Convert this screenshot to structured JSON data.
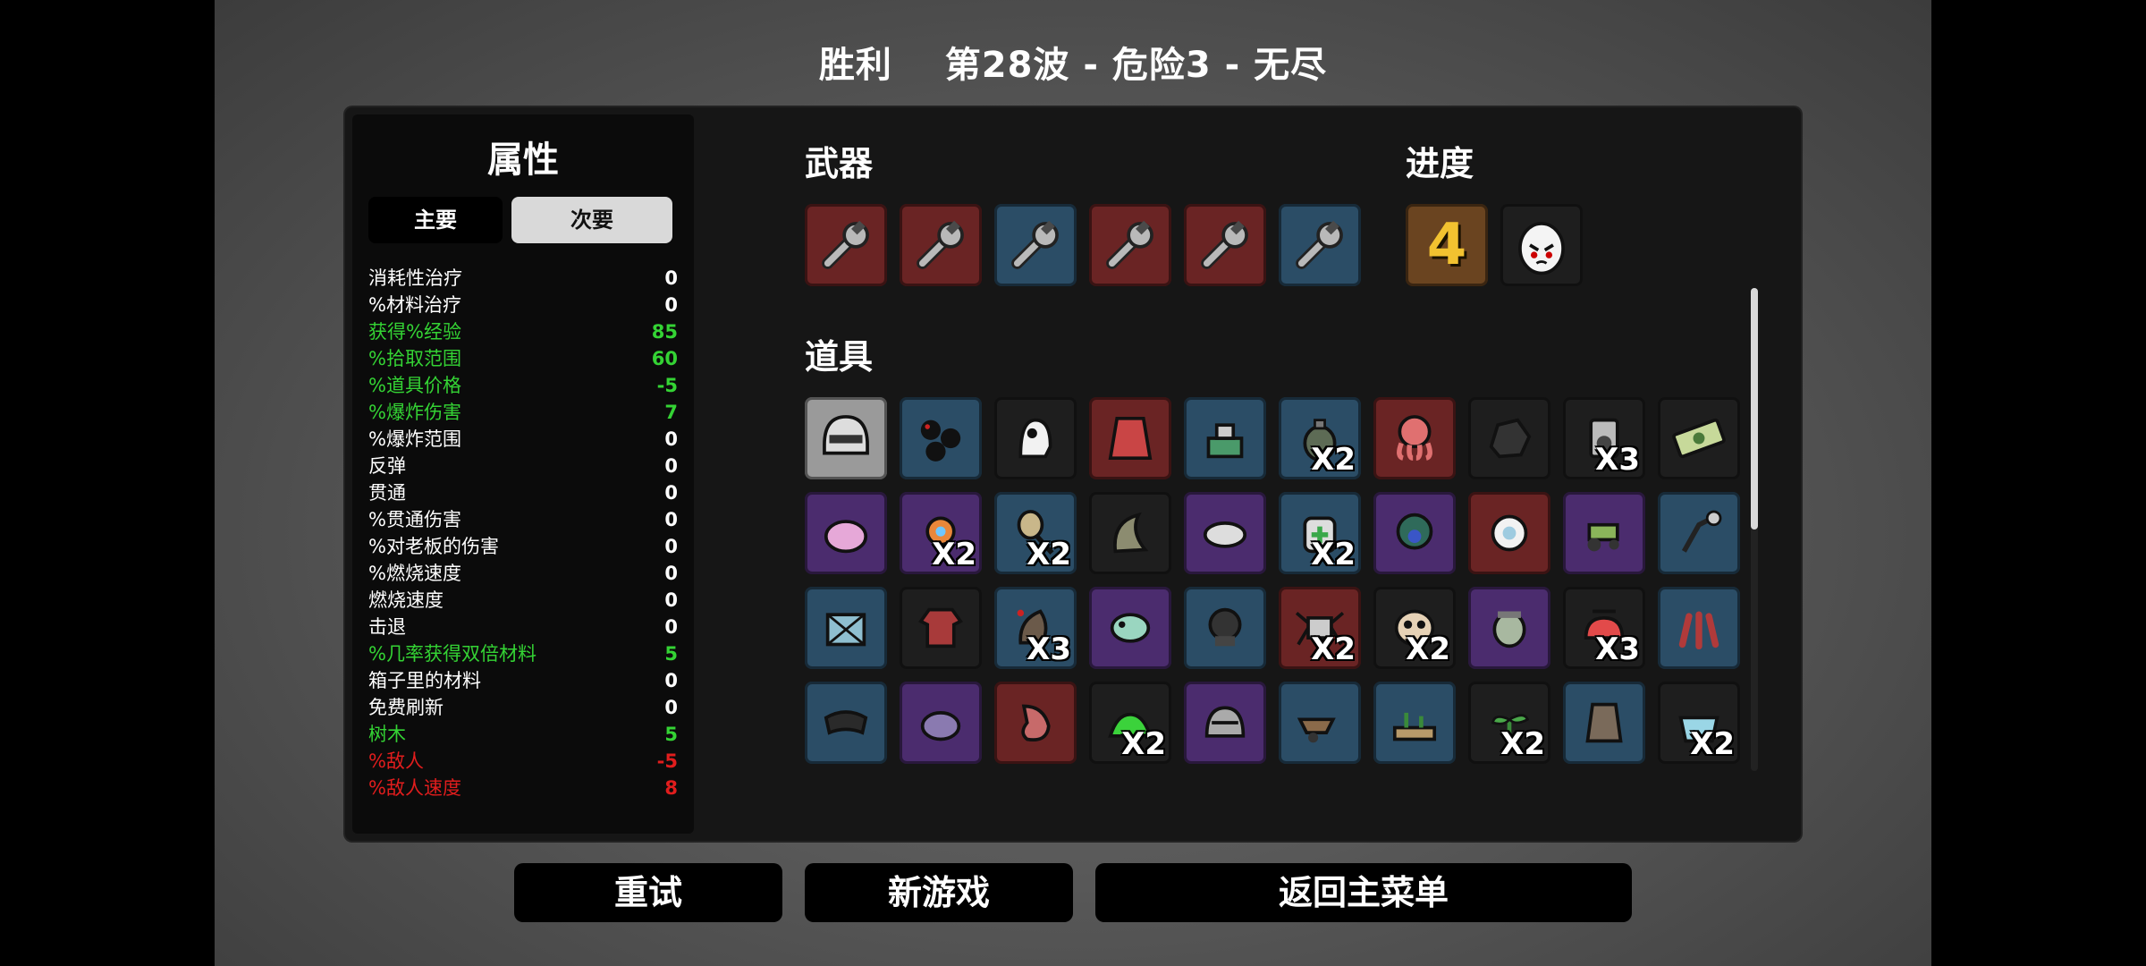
{
  "header": {
    "result": "胜利",
    "wave_info": "第28波 - 危险3 - 无尽"
  },
  "stats": {
    "title": "属性",
    "tabs": {
      "primary": "主要",
      "secondary": "次要"
    },
    "rows": [
      {
        "label": "消耗性治疗",
        "value": "0",
        "tone": "neutral"
      },
      {
        "label": "%材料治疗",
        "value": "0",
        "tone": "neutral"
      },
      {
        "label": "获得%经验",
        "value": "85",
        "tone": "pos"
      },
      {
        "label": "%拾取范围",
        "value": "60",
        "tone": "pos"
      },
      {
        "label": "%道具价格",
        "value": "-5",
        "tone": "pos"
      },
      {
        "label": "%爆炸伤害",
        "value": "7",
        "tone": "pos"
      },
      {
        "label": "%爆炸范围",
        "value": "0",
        "tone": "neutral"
      },
      {
        "label": "反弹",
        "value": "0",
        "tone": "neutral"
      },
      {
        "label": "贯通",
        "value": "0",
        "tone": "neutral"
      },
      {
        "label": "%贯通伤害",
        "value": "0",
        "tone": "neutral"
      },
      {
        "label": "%对老板的伤害",
        "value": "0",
        "tone": "neutral"
      },
      {
        "label": "%燃烧速度",
        "value": "0",
        "tone": "neutral"
      },
      {
        "label": "燃烧速度",
        "value": "0",
        "tone": "neutral"
      },
      {
        "label": "击退",
        "value": "0",
        "tone": "neutral"
      },
      {
        "label": "%几率获得双倍材料",
        "value": "5",
        "tone": "pos"
      },
      {
        "label": "箱子里的材料",
        "value": "0",
        "tone": "neutral"
      },
      {
        "label": "免费刷新",
        "value": "0",
        "tone": "neutral"
      },
      {
        "label": "树木",
        "value": "5",
        "tone": "pos"
      },
      {
        "label": "%敌人",
        "value": "-5",
        "tone": "neg"
      },
      {
        "label": "%敌人速度",
        "value": "8",
        "tone": "neg"
      }
    ]
  },
  "weapons": {
    "label": "武器",
    "items": [
      {
        "icon": "wrench-icon",
        "tier": "tier-4"
      },
      {
        "icon": "wrench-icon",
        "tier": "tier-4"
      },
      {
        "icon": "wrench-icon",
        "tier": "tier-2"
      },
      {
        "icon": "wrench-icon",
        "tier": "tier-4"
      },
      {
        "icon": "wrench-icon",
        "tier": "tier-4"
      },
      {
        "icon": "wrench-icon",
        "tier": "tier-2"
      }
    ]
  },
  "progress": {
    "label": "进度",
    "danger_level": "4",
    "character_icon": "egg-face-icon"
  },
  "items": {
    "label": "道具",
    "list": [
      {
        "icon": "helmet-icon",
        "tier": "tier-white",
        "qty": ""
      },
      {
        "icon": "bombs-icon",
        "tier": "tier-2",
        "qty": ""
      },
      {
        "icon": "ghost-icon",
        "tier": "tier-1",
        "qty": ""
      },
      {
        "icon": "cape-icon",
        "tier": "tier-4",
        "qty": ""
      },
      {
        "icon": "turret-icon",
        "tier": "tier-2",
        "qty": ""
      },
      {
        "icon": "grenade-icon",
        "tier": "tier-2",
        "qty": "X2"
      },
      {
        "icon": "octopus-icon",
        "tier": "tier-4",
        "qty": ""
      },
      {
        "icon": "rock-icon",
        "tier": "tier-1",
        "qty": ""
      },
      {
        "icon": "speaker-icon",
        "tier": "tier-1",
        "qty": "X3"
      },
      {
        "icon": "cash-icon",
        "tier": "tier-1",
        "qty": ""
      },
      {
        "icon": "brain-icon",
        "tier": "tier-3",
        "qty": ""
      },
      {
        "icon": "robot-icon",
        "tier": "tier-3",
        "qty": "X2"
      },
      {
        "icon": "mirror-icon",
        "tier": "tier-2",
        "qty": "X2"
      },
      {
        "icon": "horn-icon",
        "tier": "tier-1",
        "qty": ""
      },
      {
        "icon": "tardigrade-icon",
        "tier": "tier-3",
        "qty": ""
      },
      {
        "icon": "medkit-icon",
        "tier": "tier-2",
        "qty": "X2"
      },
      {
        "icon": "peacock-icon",
        "tier": "tier-3",
        "qty": ""
      },
      {
        "icon": "burst-icon",
        "tier": "tier-4",
        "qty": ""
      },
      {
        "icon": "tractor-icon",
        "tier": "tier-3",
        "qty": ""
      },
      {
        "icon": "lamp-icon",
        "tier": "tier-2",
        "qty": ""
      },
      {
        "icon": "crate-icon",
        "tier": "tier-2",
        "qty": ""
      },
      {
        "icon": "shirt-icon",
        "tier": "tier-1",
        "qty": ""
      },
      {
        "icon": "larva-icon",
        "tier": "tier-2",
        "qty": "X3"
      },
      {
        "icon": "chameleon-icon",
        "tier": "tier-3",
        "qty": ""
      },
      {
        "icon": "diving-helmet-icon",
        "tier": "tier-2",
        "qty": ""
      },
      {
        "icon": "spider-bot-icon",
        "tier": "tier-4",
        "qty": "X2"
      },
      {
        "icon": "mask-icon",
        "tier": "tier-1",
        "qty": "X2"
      },
      {
        "icon": "zombie-icon",
        "tier": "tier-3",
        "qty": ""
      },
      {
        "icon": "propeller-hat-icon",
        "tier": "tier-1",
        "qty": "X3"
      },
      {
        "icon": "claws-icon",
        "tier": "tier-2",
        "qty": ""
      },
      {
        "icon": "scarf-icon",
        "tier": "tier-2",
        "qty": ""
      },
      {
        "icon": "blob-icon",
        "tier": "tier-3",
        "qty": ""
      },
      {
        "icon": "stomach-icon",
        "tier": "tier-4",
        "qty": ""
      },
      {
        "icon": "slime-icon",
        "tier": "tier-1",
        "qty": "X2"
      },
      {
        "icon": "knight-helmet-icon",
        "tier": "tier-3",
        "qty": ""
      },
      {
        "icon": "wheelbarrow-icon",
        "tier": "tier-2",
        "qty": ""
      },
      {
        "icon": "garden-icon",
        "tier": "tier-2",
        "qty": ""
      },
      {
        "icon": "sprout-icon",
        "tier": "tier-1",
        "qty": "X2"
      },
      {
        "icon": "vest-icon",
        "tier": "tier-2",
        "qty": ""
      },
      {
        "icon": "bucket-icon",
        "tier": "tier-1",
        "qty": "X2"
      }
    ]
  },
  "buttons": {
    "retry": "重试",
    "new_game": "新游戏",
    "main_menu": "返回主菜单"
  }
}
